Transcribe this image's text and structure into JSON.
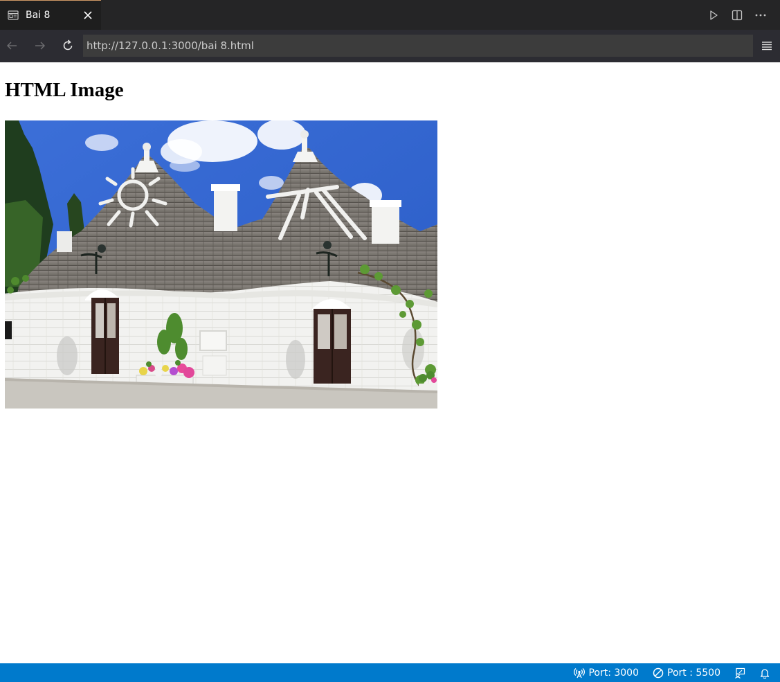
{
  "tab": {
    "title": "Bai 8",
    "icon": "browser-preview-icon",
    "close_icon": "close-icon",
    "accent": "#d19a66"
  },
  "tab_actions": [
    {
      "icon": "run-icon"
    },
    {
      "icon": "split-editor-icon"
    },
    {
      "icon": "more-actions-icon"
    }
  ],
  "nav": {
    "back_icon": "arrow-left-icon",
    "forward_icon": "arrow-right-icon",
    "reload_icon": "reload-icon",
    "url": "http://127.0.0.1:3000/bai 8.html",
    "menu_icon": "hamburger-menu-icon"
  },
  "page": {
    "heading": "HTML Image",
    "image": "trulli-houses-photo"
  },
  "statusbar": {
    "background": "#007acc",
    "items": [
      {
        "icon": "broadcast-icon",
        "label": "Port: 3000"
      },
      {
        "icon": "circle-slash-icon",
        "label": "Port : 5500"
      },
      {
        "icon": "feedback-icon",
        "label": ""
      },
      {
        "icon": "bell-icon",
        "label": ""
      }
    ]
  }
}
